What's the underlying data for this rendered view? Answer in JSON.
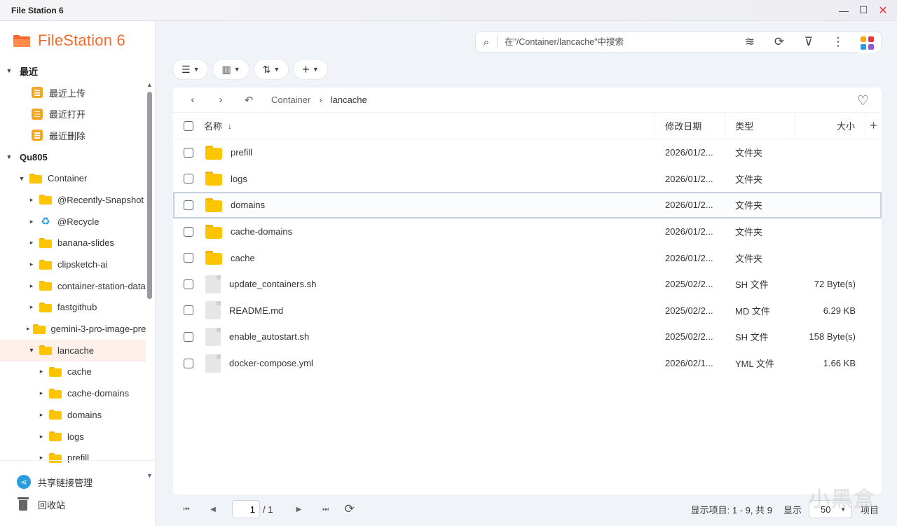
{
  "window": {
    "title": "File Station 6",
    "minimize": "—",
    "maximize": "☐",
    "close": "✕"
  },
  "app": {
    "name": "FileStation 6"
  },
  "sidebar": {
    "recent": {
      "label": "最近",
      "items": [
        "最近上传",
        "最近打开",
        "最近删除"
      ]
    },
    "nas": {
      "label": "Qu805",
      "root": "Container",
      "folders": [
        {
          "label": "@Recently-Snapshot",
          "icon": "folder-icon"
        },
        {
          "label": "@Recycle",
          "icon": "recycle-icon"
        },
        {
          "label": "banana-slides",
          "icon": "folder-icon"
        },
        {
          "label": "clipsketch-ai",
          "icon": "folder-icon"
        },
        {
          "label": "container-station-data",
          "icon": "folder-icon"
        },
        {
          "label": "fastgithub",
          "icon": "folder-icon"
        },
        {
          "label": "gemini-3-pro-image-preview",
          "icon": "folder-icon"
        },
        {
          "label": "lancache",
          "icon": "folder-icon",
          "selected": true,
          "expanded": true
        }
      ],
      "lancache_children": [
        "cache",
        "cache-domains",
        "domains",
        "logs",
        "prefill"
      ]
    },
    "footer": {
      "share_label": "共享链接管理",
      "trash_label": "回收站"
    }
  },
  "search": {
    "placeholder": "在\"/Container/lancache\"中搜索",
    "value": ""
  },
  "toolbar": {
    "icons": [
      "stack-icon",
      "sync-icon",
      "filter-plus-icon",
      "more-icon"
    ],
    "apps_colors": [
      "#f5a623",
      "#e0383e",
      "#2a9dde",
      "#8e5bd8"
    ]
  },
  "breadcrumb": {
    "parent": "Container",
    "current": "lancache"
  },
  "table": {
    "headers": {
      "name": "名称",
      "date": "修改日期",
      "type": "类型",
      "size": "大小"
    },
    "rows": [
      {
        "name": "prefill",
        "date": "2026/01/2...",
        "type": "文件夹",
        "size": "",
        "kind": "folder"
      },
      {
        "name": "logs",
        "date": "2026/01/2...",
        "type": "文件夹",
        "size": "",
        "kind": "folder"
      },
      {
        "name": "domains",
        "date": "2026/01/2...",
        "type": "文件夹",
        "size": "",
        "kind": "folder",
        "highlighted": true
      },
      {
        "name": "cache-domains",
        "date": "2026/01/2...",
        "type": "文件夹",
        "size": "",
        "kind": "folder"
      },
      {
        "name": "cache",
        "date": "2026/01/2...",
        "type": "文件夹",
        "size": "",
        "kind": "folder"
      },
      {
        "name": "update_containers.sh",
        "date": "2025/02/2...",
        "type": "SH 文件",
        "size": "72 Byte(s)",
        "kind": "file"
      },
      {
        "name": "README.md",
        "date": "2025/02/2...",
        "type": "MD 文件",
        "size": "6.29 KB",
        "kind": "file"
      },
      {
        "name": "enable_autostart.sh",
        "date": "2025/02/2...",
        "type": "SH 文件",
        "size": "158 Byte(s)",
        "kind": "file"
      },
      {
        "name": "docker-compose.yml",
        "date": "2026/02/1...",
        "type": "YML 文件",
        "size": "1.66 KB",
        "kind": "file"
      }
    ]
  },
  "pager": {
    "page": "1",
    "total": "/ 1",
    "info": "显示项目: 1 - 9, 共 9",
    "show_label": "显示",
    "per_page": "50",
    "items_label": "项目"
  },
  "watermark": "小黑盒"
}
